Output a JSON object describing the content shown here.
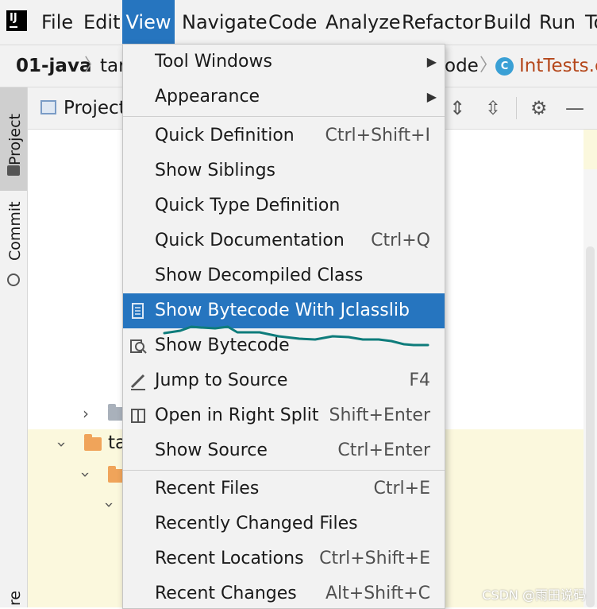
{
  "menubar": {
    "app_logo": "IJ",
    "items": [
      "File",
      "Edit",
      "View",
      "Navigate",
      "Code",
      "Analyze",
      "Refactor",
      "Build",
      "Run",
      "To"
    ]
  },
  "navbar": {
    "project": "01-java",
    "crumb2": "tar",
    "crumb3": "ode",
    "class_icon": "C",
    "file": "IntTests.cl"
  },
  "toolstrip": {
    "project_tab": "Project",
    "commit_tab": "Commit",
    "bottom_tab": "re"
  },
  "project_panel": {
    "title": "Project",
    "tree": [
      {
        "label": ""
      },
      {
        "label": "ta"
      },
      {
        "label": ""
      },
      {
        "label": ""
      }
    ]
  },
  "view_menu": {
    "items": [
      {
        "label": "Tool Windows",
        "shortcut": "",
        "submenu": true
      },
      {
        "label": "Appearance",
        "shortcut": "",
        "submenu": true
      },
      {
        "label": "Quick Definition",
        "shortcut": "Ctrl+Shift+I"
      },
      {
        "label": "Show Siblings",
        "shortcut": ""
      },
      {
        "label": "Quick Type Definition",
        "shortcut": ""
      },
      {
        "label": "Quick Documentation",
        "shortcut": "Ctrl+Q"
      },
      {
        "label": "Show Decompiled Class",
        "shortcut": ""
      },
      {
        "label": "Show Bytecode With Jclasslib",
        "shortcut": "",
        "selected": true
      },
      {
        "label": "Show Bytecode",
        "shortcut": ""
      },
      {
        "label": "Jump to Source",
        "shortcut": "F4"
      },
      {
        "label": "Open in Right Split",
        "shortcut": "Shift+Enter"
      },
      {
        "label": "Show Source",
        "shortcut": "Ctrl+Enter"
      },
      {
        "label": "Recent Files",
        "shortcut": "Ctrl+E"
      },
      {
        "label": "Recently Changed Files",
        "shortcut": ""
      },
      {
        "label": "Recent Locations",
        "shortcut": "Ctrl+Shift+E"
      },
      {
        "label": "Recent Changes",
        "shortcut": "Alt+Shift+C"
      }
    ]
  },
  "colors": {
    "accent": "#2675bf",
    "annotation": "#0e7c7b",
    "folder_orange": "#f0a45a",
    "highlight_yellow": "#fbf8dd"
  },
  "watermark": "CSDN @雨田说码"
}
